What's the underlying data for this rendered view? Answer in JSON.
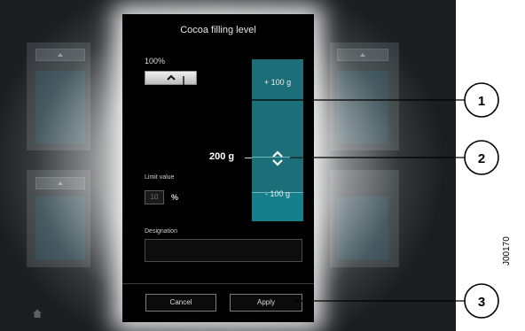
{
  "dialog": {
    "title": "Cocoa filling level",
    "percent_label": "100%",
    "slider": {
      "top_label": "+ 100 g",
      "bottom_label": "- 100 g"
    },
    "value_label": "200 g",
    "limit": {
      "label": "Limit value",
      "value": "10",
      "unit": "%"
    },
    "designation": {
      "label": "Designation",
      "value": ""
    },
    "buttons": {
      "cancel": "Cancel",
      "apply": "Apply"
    }
  },
  "callouts": [
    "1",
    "2",
    "3"
  ],
  "doc_code": "J00170",
  "colors": {
    "dialog_bg": "#000000",
    "slider": "#1c6f78",
    "screen_bg": "#1b1d1f"
  }
}
